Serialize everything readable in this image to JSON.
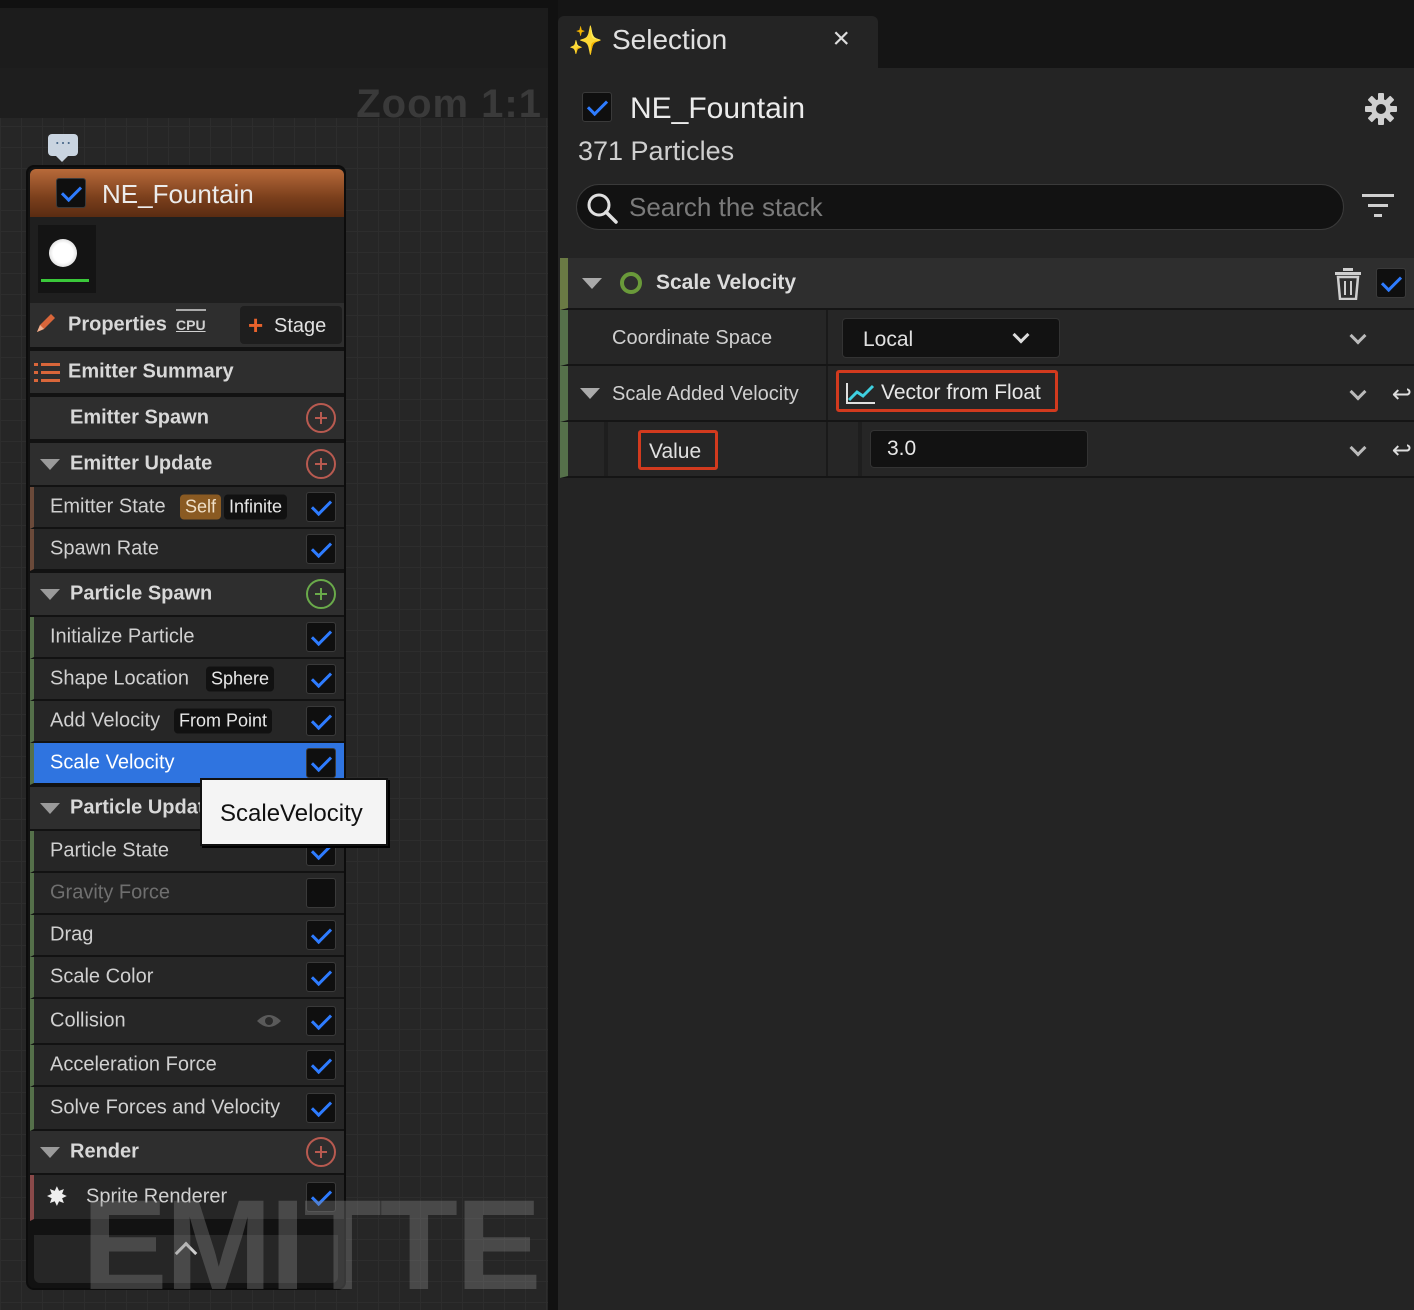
{
  "graph": {
    "zoom_label": "Zoom 1:1",
    "watermark": "EMITTER"
  },
  "node": {
    "title": "NE_Fountain",
    "enabled": true,
    "properties_label": "Properties",
    "cpu_label": "CPU",
    "stage_label": "Stage",
    "emitter_summary": "Emitter Summary",
    "sections": {
      "emitter_spawn": "Emitter Spawn",
      "emitter_update": "Emitter Update",
      "particle_spawn": "Particle Spawn",
      "particle_update": "Particle Update",
      "render": "Render"
    },
    "modules": {
      "emitter_state": "Emitter State",
      "emitter_state_tag1": "Self",
      "emitter_state_tag2": "Infinite",
      "spawn_rate": "Spawn Rate",
      "initialize_particle": "Initialize Particle",
      "shape_location": "Shape Location",
      "shape_location_tag": "Sphere",
      "add_velocity": "Add Velocity",
      "add_velocity_tag": "From Point",
      "scale_velocity": "Scale Velocity",
      "particle_state": "Particle State",
      "gravity_force": "Gravity Force",
      "drag": "Drag",
      "scale_color": "Scale Color",
      "collision": "Collision",
      "acceleration_force": "Acceleration Force",
      "solve_forces": "Solve Forces and Velocity",
      "sprite_renderer": "Sprite Renderer"
    },
    "tooltip": "ScaleVelocity"
  },
  "panel": {
    "tab_title": "Selection",
    "emitter_name": "NE_Fountain",
    "particle_count": "371 Particles",
    "search_placeholder": "Search the stack",
    "module_title": "Scale Velocity",
    "params": {
      "coordinate_space_label": "Coordinate Space",
      "coordinate_space_value": "Local",
      "scale_added_velocity_label": "Scale Added Velocity",
      "scale_added_velocity_value": "Vector from Float",
      "value_label": "Value",
      "value_value": "3.0"
    }
  },
  "colors": {
    "accent_blue": "#2f74e0",
    "highlight_red": "#d23a1e",
    "header_orange": "#b86a3a"
  }
}
